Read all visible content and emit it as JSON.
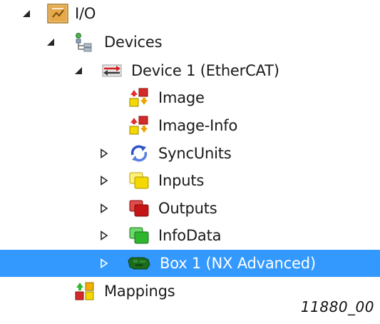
{
  "tree": {
    "io": {
      "label": "I/O",
      "icon": "io-folder-icon",
      "expanded": true
    },
    "devices": {
      "label": "Devices",
      "icon": "devices-tree-icon",
      "expanded": true
    },
    "device1": {
      "label": "Device 1 (EtherCAT)",
      "icon": "ethercat-device-icon",
      "expanded": true
    },
    "image": {
      "label": "Image",
      "icon": "image-icon"
    },
    "image_info": {
      "label": "Image-Info",
      "icon": "image-info-icon"
    },
    "syncunits": {
      "label": "SyncUnits",
      "icon": "sync-arrows-icon",
      "expanded": false
    },
    "inputs": {
      "label": "Inputs",
      "icon": "inputs-icon",
      "expanded": false
    },
    "outputs": {
      "label": "Outputs",
      "icon": "outputs-icon",
      "expanded": false
    },
    "infodata": {
      "label": "InfoData",
      "icon": "infodata-icon",
      "expanded": false
    },
    "box1": {
      "label": "Box 1 (NX Advanced)",
      "icon": "box-module-icon",
      "expanded": false,
      "selected": true
    },
    "mappings": {
      "label": "Mappings",
      "icon": "mappings-icon"
    }
  },
  "figure_id": "11880_00",
  "colors": {
    "selection": "#3399ff",
    "inputs": "#f5d800",
    "outputs": "#cc1f1f",
    "infodata": "#2fb62f",
    "box": "#1f7a1f"
  }
}
